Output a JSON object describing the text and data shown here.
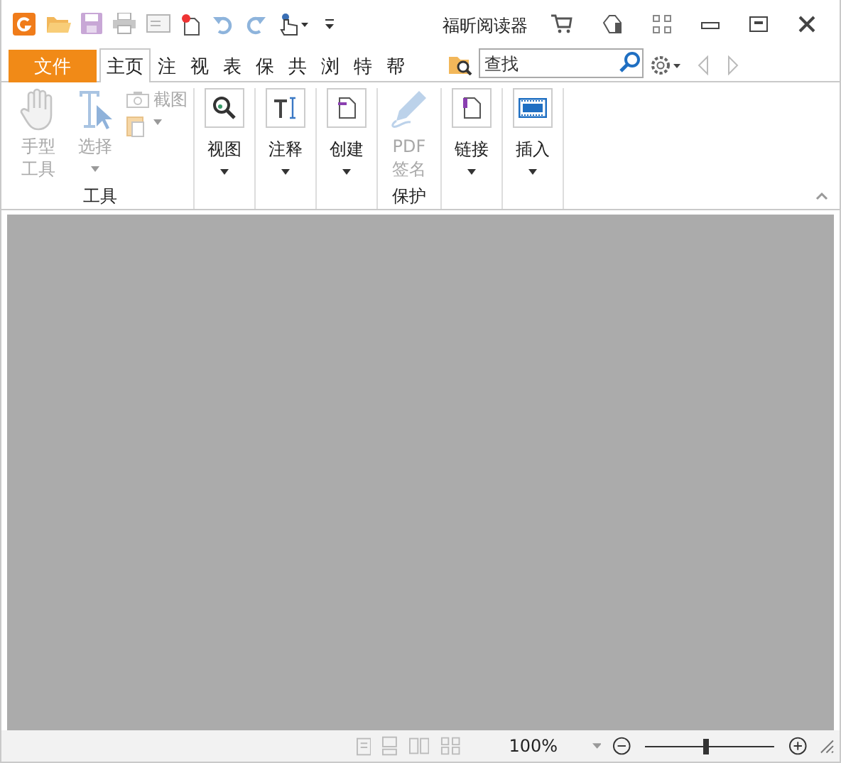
{
  "window": {
    "title": "福昕阅读器"
  },
  "tabs": [
    {
      "label": "文件",
      "kind": "file",
      "selected": false
    },
    {
      "label": "主页",
      "kind": "tab",
      "selected": true
    },
    {
      "label": "注",
      "kind": "tab",
      "selected": false
    },
    {
      "label": "视",
      "kind": "tab",
      "selected": false
    },
    {
      "label": "表",
      "kind": "tab",
      "selected": false
    },
    {
      "label": "保",
      "kind": "tab",
      "selected": false
    },
    {
      "label": "共",
      "kind": "tab",
      "selected": false
    },
    {
      "label": "浏",
      "kind": "tab",
      "selected": false
    },
    {
      "label": "特",
      "kind": "tab",
      "selected": false
    },
    {
      "label": "帮",
      "kind": "tab",
      "selected": false
    }
  ],
  "search": {
    "placeholder": "查找"
  },
  "ribbon": {
    "groups": [
      {
        "label": "工具",
        "buttons": [
          {
            "kind": "large",
            "label": "手型工具",
            "disabled": true,
            "dropdown": false
          },
          {
            "kind": "large",
            "label": "选择",
            "disabled": true,
            "dropdown": true
          },
          {
            "kind": "small",
            "label": "截图",
            "disabled": true,
            "dropdown": false
          },
          {
            "kind": "small",
            "disabled": true,
            "dropdown": true
          }
        ]
      },
      {
        "buttons": [
          {
            "kind": "framed",
            "label": "视图",
            "disabled": false,
            "dropdown": true
          }
        ]
      },
      {
        "buttons": [
          {
            "kind": "framed",
            "label": "注释",
            "disabled": false,
            "dropdown": true
          }
        ]
      },
      {
        "buttons": [
          {
            "kind": "framed",
            "label": "创建",
            "disabled": false,
            "dropdown": true
          }
        ]
      },
      {
        "label": "保护",
        "buttons": [
          {
            "kind": "large",
            "label": "PDF签名",
            "disabled": true,
            "dropdown": false
          }
        ]
      },
      {
        "buttons": [
          {
            "kind": "framed",
            "label": "链接",
            "disabled": false,
            "dropdown": true
          }
        ]
      },
      {
        "buttons": [
          {
            "kind": "framed",
            "label": "插入",
            "disabled": false,
            "dropdown": true
          }
        ]
      }
    ]
  },
  "status_bar": {
    "zoom": "100%",
    "level": 0.47
  }
}
